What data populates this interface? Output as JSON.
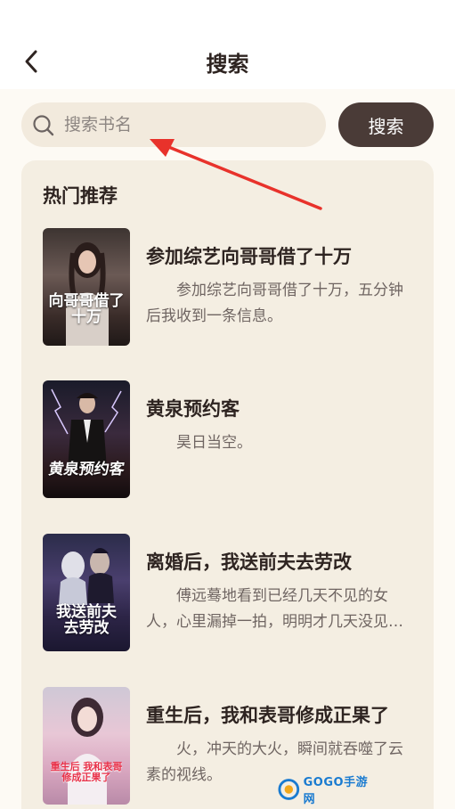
{
  "header": {
    "title": "搜索",
    "back_icon": "chevron-left-icon"
  },
  "search": {
    "placeholder": "搜索书名",
    "value": "",
    "button_label": "搜索",
    "icon": "search-icon"
  },
  "recommend": {
    "title": "热门推荐",
    "books": [
      {
        "title": "参加综艺向哥哥借了十万",
        "desc": "参加综艺向哥哥借了十万，五分钟后我收到一条信息。",
        "cover_text": "向哥哥借了十万"
      },
      {
        "title": "黄泉预约客",
        "desc": "昊日当空。",
        "cover_text": "黄泉预约客"
      },
      {
        "title": "离婚后，我送前夫去劳改",
        "desc": "傅远蓦地看到已经几天不见的女人，心里漏掉一拍，明明才几天没见，她怎么好像变了一个人。",
        "cover_text": "我送前夫去劳改"
      },
      {
        "title": "重生后，我和表哥修成正果了",
        "desc": "火，冲天的大火，瞬间就吞噬了云素的视线。",
        "cover_text": "重生后 我和表哥修成正果了"
      }
    ]
  },
  "watermark": {
    "text": "GOGO手游网"
  },
  "colors": {
    "accent": "#4a3b37",
    "background": "#fdfaf4",
    "panel": "#f4eee2",
    "arrow": "#e8322b"
  }
}
